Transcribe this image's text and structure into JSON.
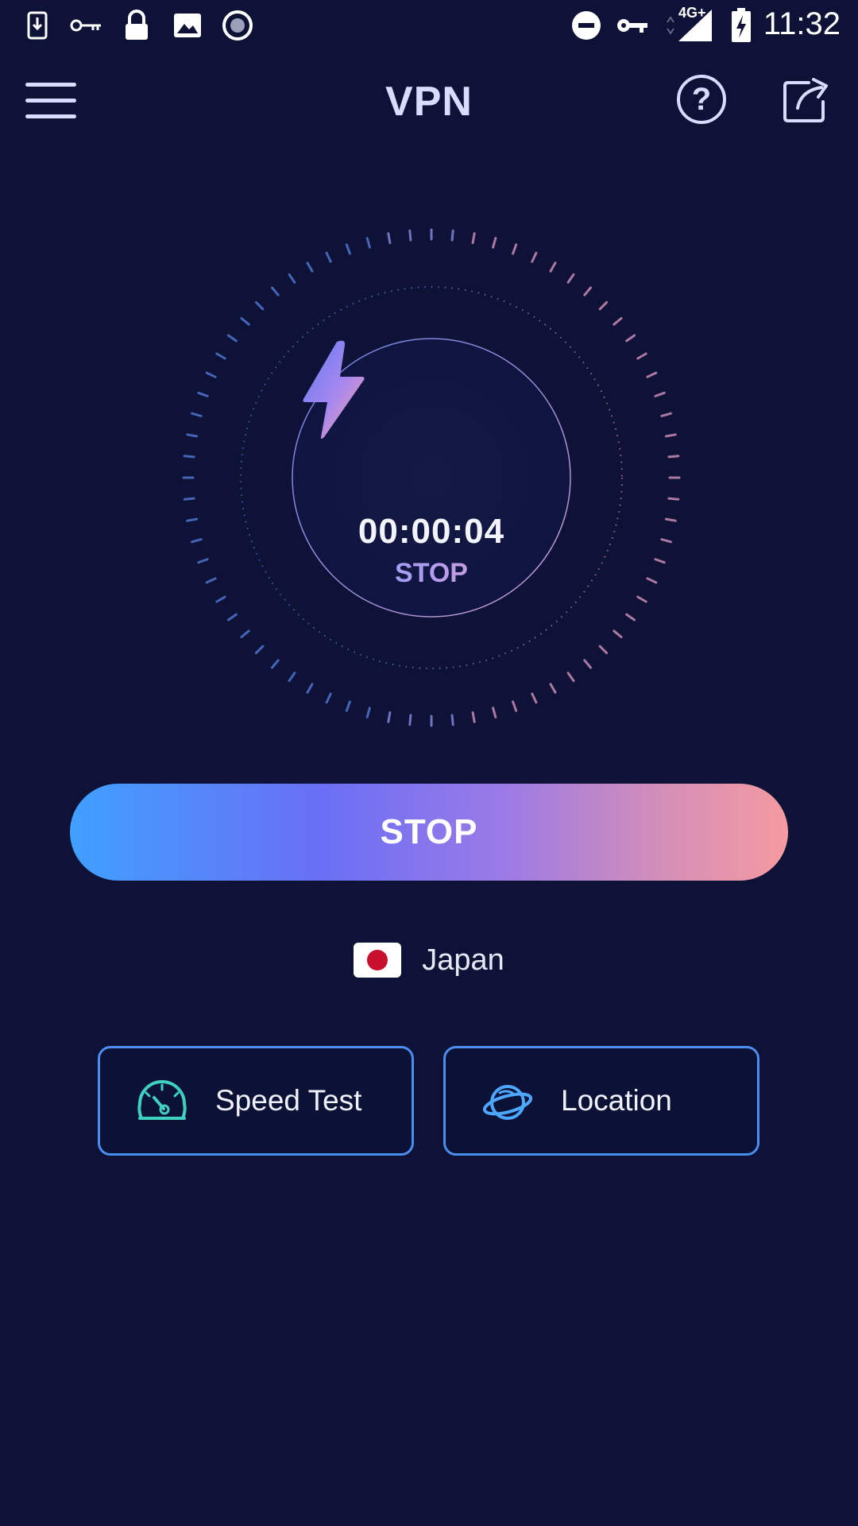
{
  "status_bar": {
    "time": "11:32",
    "network": "4G+"
  },
  "app_bar": {
    "title": "VPN",
    "help_glyph": "?"
  },
  "dial": {
    "timer": "00:00:04",
    "state_label": "STOP"
  },
  "main_button": {
    "label": "STOP"
  },
  "server": {
    "country": "Japan"
  },
  "tools": [
    {
      "label": "Speed Test",
      "icon": "speedometer-icon"
    },
    {
      "label": "Location",
      "icon": "planet-icon"
    }
  ],
  "colors": {
    "background": "#0d1236",
    "accent_blue": "#4b8ef0",
    "gradient_start": "#3fa0ff",
    "gradient_mid": "#6a6ff5",
    "gradient_end": "#f59aa0",
    "speed_icon": "#3fd0c0"
  }
}
